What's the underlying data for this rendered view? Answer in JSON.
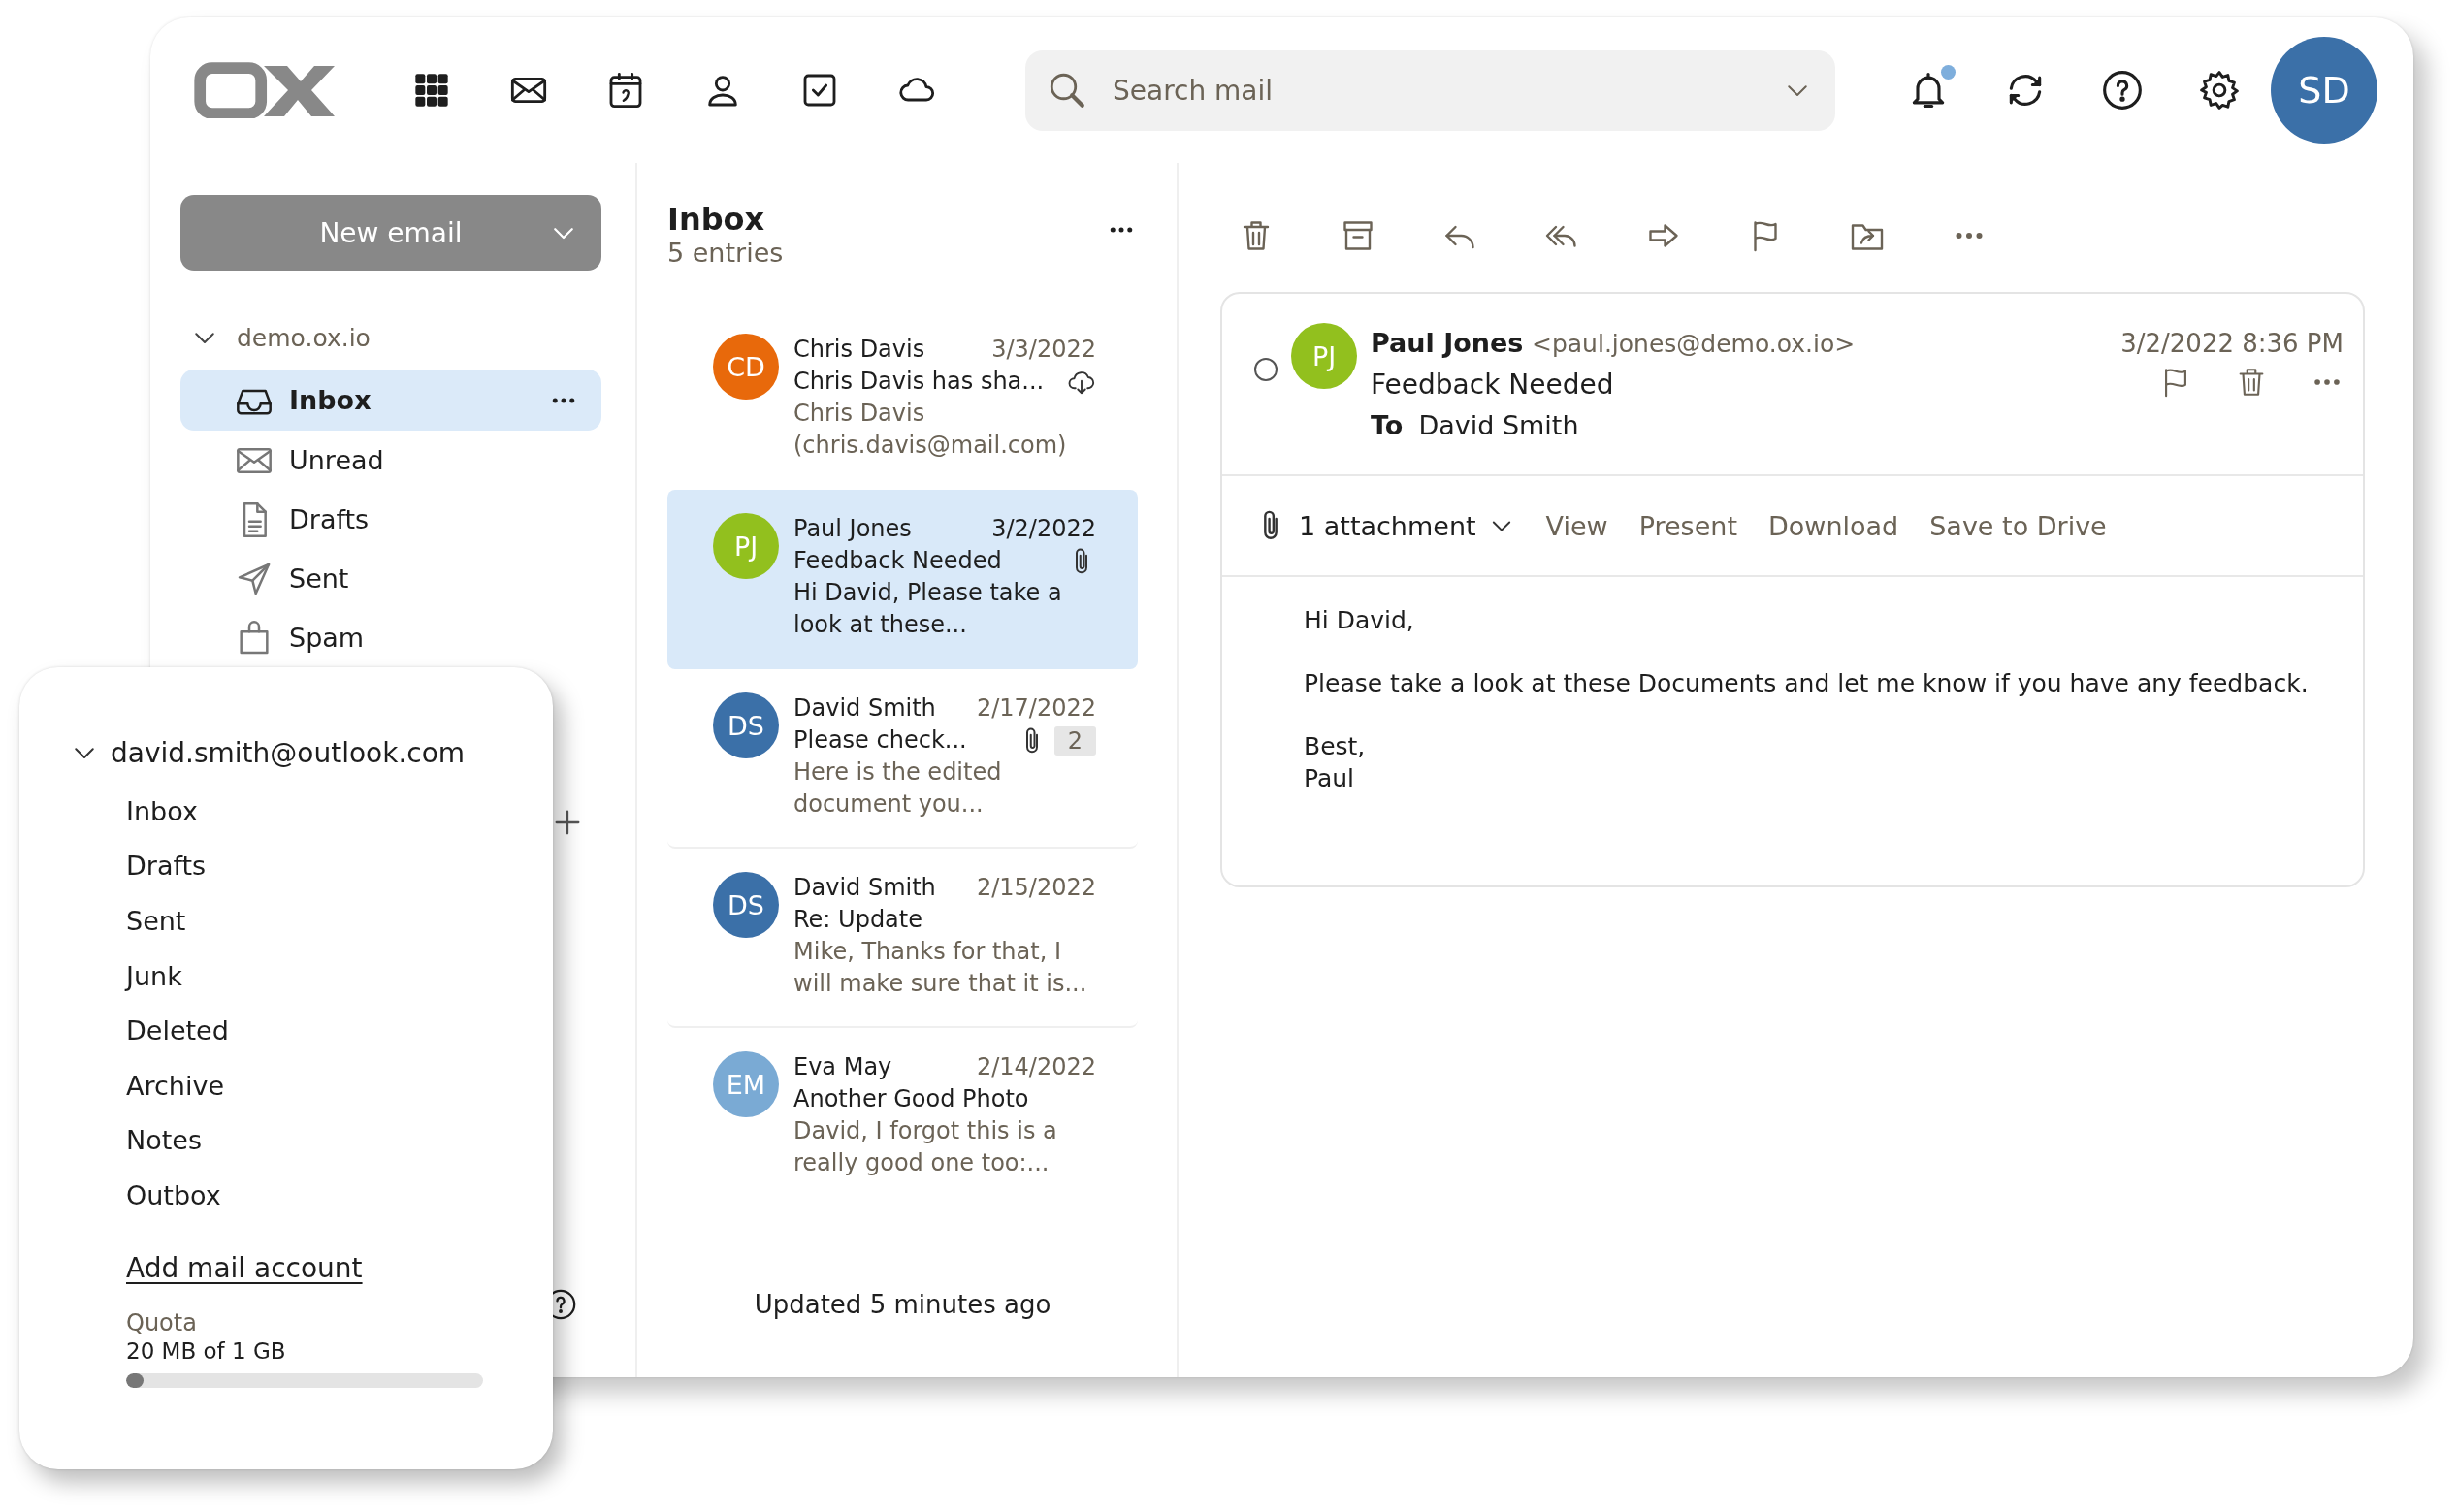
{
  "top_bar": {
    "search": {
      "placeholder": "Search mail"
    },
    "notifications": {
      "has_new": true
    },
    "user": {
      "initials": "SD"
    }
  },
  "sidebar": {
    "new_email_button": "New email",
    "account": {
      "name": "demo.ox.io",
      "expanded": true
    },
    "folders": [
      {
        "label": "Inbox",
        "kind": "inbox",
        "selected": true
      },
      {
        "label": "Unread",
        "kind": "unread",
        "selected": false
      },
      {
        "label": "Drafts",
        "kind": "drafts",
        "selected": false
      },
      {
        "label": "Sent",
        "kind": "sent",
        "selected": false
      },
      {
        "label": "Spam",
        "kind": "spam",
        "selected": false
      }
    ]
  },
  "mail_list": {
    "title": "Inbox",
    "count": "5 entries",
    "items": [
      {
        "initials": "CD",
        "color": "#e8690b",
        "sender": "Chris Davis",
        "date": "3/3/2022",
        "subject": "Chris Davis has sha...",
        "preview": "Chris Davis (chris.davis@mail.com)",
        "attachment": false,
        "shared_file": true,
        "selected": false
      },
      {
        "initials": "PJ",
        "color": "#92c01e",
        "sender": "Paul Jones",
        "date": "3/2/2022",
        "subject": "Feedback Needed",
        "preview": "Hi David, Please take a look at these...",
        "attachment": true,
        "shared_file": false,
        "selected": true
      },
      {
        "initials": "DS",
        "color": "#3b70a8",
        "sender": "David Smith",
        "date": "2/17/2022",
        "subject": "Please check...",
        "preview": "Here is the edited document you...",
        "attachment": true,
        "shared_file": false,
        "thread_count": "2",
        "selected": false
      },
      {
        "initials": "DS",
        "color": "#3b70a8",
        "sender": "David Smith",
        "date": "2/15/2022",
        "subject": "Re: Update",
        "preview": "Mike, Thanks for that, I will make sure that it is...",
        "attachment": false,
        "shared_file": false,
        "selected": false
      },
      {
        "initials": "EM",
        "color": "#7aaad4",
        "sender": "Eva May",
        "date": "2/14/2022",
        "subject": "Another Good Photo",
        "preview": "David, I forgot this is a really good one too:...",
        "attachment": false,
        "shared_file": false,
        "selected": false
      }
    ],
    "status": "Updated 5 minutes ago"
  },
  "reader": {
    "checked": false,
    "initials": "PJ",
    "from_name": "Paul Jones",
    "from_address": "<paul.jones@demo.ox.io>",
    "subject": "Feedback Needed",
    "to_label": "To",
    "to": "David Smith",
    "date": "3/2/2022 8:36 PM",
    "attachments": {
      "label": "1 attachment",
      "actions": [
        "View",
        "Present",
        "Download",
        "Save to Drive"
      ]
    },
    "body": [
      [
        "Hi David,"
      ],
      [
        "Please take a look at these Documents and let me know if you have any feedback."
      ],
      [
        "Best,",
        "Paul"
      ]
    ]
  },
  "account_panel": {
    "account": {
      "name": "david.smith@outlook.com",
      "expanded": true
    },
    "folders": [
      "Inbox",
      "Drafts",
      "Sent",
      "Junk",
      "Deleted",
      "Archive",
      "Notes",
      "Outbox"
    ],
    "add_account": "Add mail account",
    "quota": {
      "label": "Quota",
      "usage": "20 MB of 1 GB",
      "level": 0.05
    }
  }
}
